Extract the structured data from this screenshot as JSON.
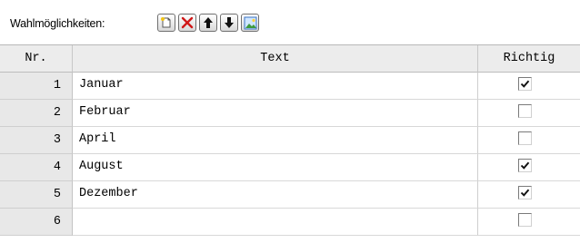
{
  "toolbar": {
    "label": "Wahlmöglichkeiten:",
    "buttons": [
      {
        "name": "new-item-button",
        "icon": "new-document-icon"
      },
      {
        "name": "delete-item-button",
        "icon": "delete-x-icon",
        "color": "#d01818"
      },
      {
        "name": "move-up-button",
        "icon": "arrow-up-icon"
      },
      {
        "name": "move-down-button",
        "icon": "arrow-down-icon"
      },
      {
        "name": "insert-image-button",
        "icon": "image-icon"
      }
    ]
  },
  "table": {
    "columns": [
      "Nr.",
      "Text",
      "Richtig"
    ],
    "rows": [
      {
        "nr": "1",
        "text": "Januar",
        "richtig": true
      },
      {
        "nr": "2",
        "text": "Februar",
        "richtig": false
      },
      {
        "nr": "3",
        "text": "April",
        "richtig": false
      },
      {
        "nr": "4",
        "text": "August",
        "richtig": true
      },
      {
        "nr": "5",
        "text": "Dezember",
        "richtig": true
      },
      {
        "nr": "6",
        "text": "",
        "richtig": false
      }
    ]
  }
}
